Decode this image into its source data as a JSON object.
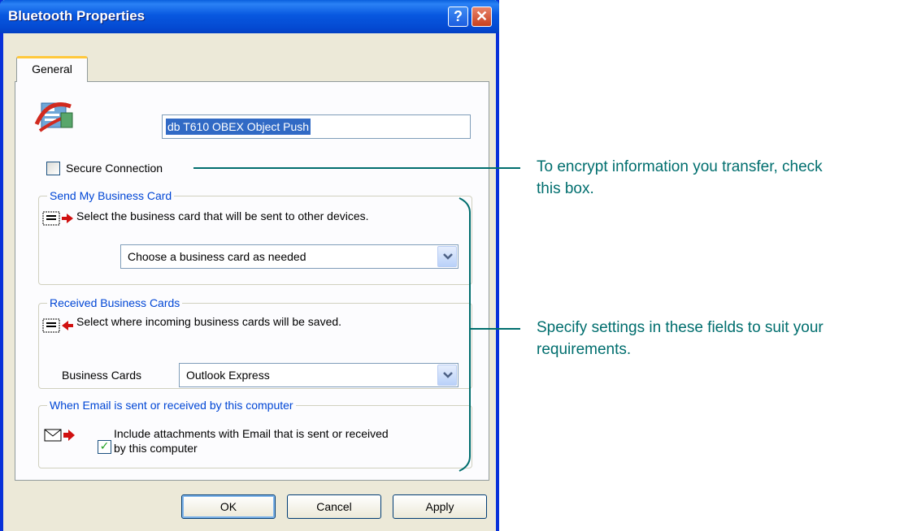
{
  "window": {
    "title": "Bluetooth Properties",
    "help_glyph": "?",
    "close_glyph": "✕"
  },
  "tabs": [
    {
      "label": "General",
      "selected": true
    }
  ],
  "general": {
    "device_name": "db T610 OBEX Object Push",
    "secure_connection": {
      "label": "Secure Connection",
      "checked": false
    }
  },
  "send_card": {
    "legend": "Send My Business Card",
    "description": "Select the business card that will be sent to other devices.",
    "combo_value": "Choose a business card as needed"
  },
  "received_cards": {
    "legend": "Received Business Cards",
    "description": "Select where incoming business cards will be saved.",
    "field_label": "Business Cards",
    "combo_value": "Outlook Express"
  },
  "email": {
    "legend": "When Email is sent or received by this computer",
    "checkbox_label_line1": "Include attachments with Email that is sent or received",
    "checkbox_label_line2": "by this computer",
    "checked": true,
    "check_glyph": "✓"
  },
  "buttons": {
    "ok": "OK",
    "cancel": "Cancel",
    "apply": "Apply"
  },
  "callouts": {
    "secure_line1": "To encrypt information you transfer, check",
    "secure_line2": "this box.",
    "settings_line1": "Specify settings in these fields to suit your",
    "settings_line2": "requirements."
  },
  "colors": {
    "callout": "#006e6e",
    "legend": "#0046d5",
    "titlebar": "#0858e0"
  },
  "icons": [
    "help-icon",
    "close-icon",
    "obex-app-icon",
    "business-card-send-icon",
    "business-card-receive-icon",
    "email-send-icon",
    "dropdown-arrow-icon"
  ]
}
